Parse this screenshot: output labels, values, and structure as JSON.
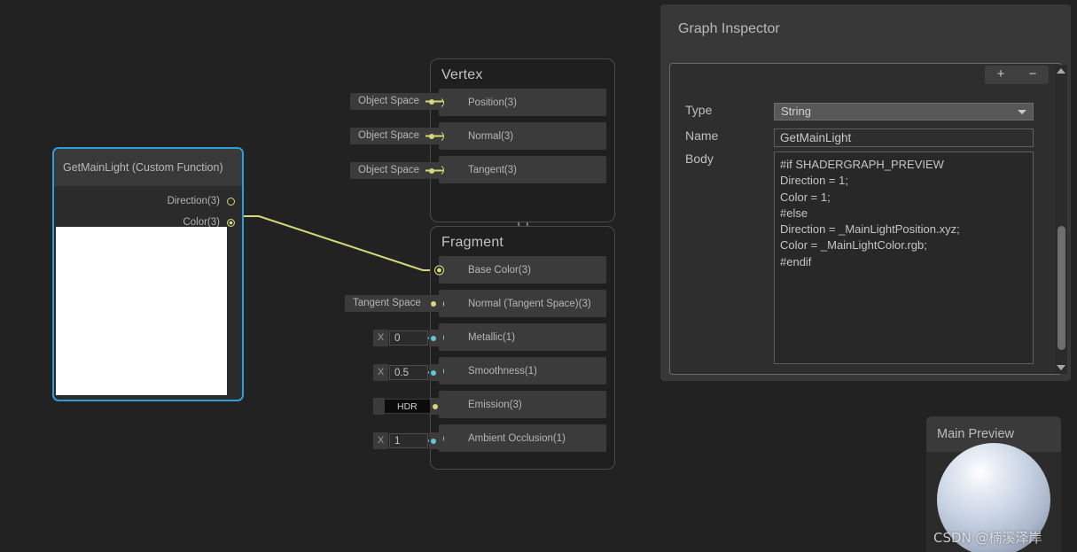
{
  "canvas": {
    "background": "#222222"
  },
  "custom_function_node": {
    "title": "GetMainLight (Custom Function)",
    "selected_border_color": "#2e9ed6",
    "ports": [
      {
        "label": "Direction(3)",
        "type": "vector3",
        "connected": false
      },
      {
        "label": "Color(3)",
        "type": "vector3",
        "connected": true
      }
    ],
    "preview_color": "#ffffff"
  },
  "vertex_stack": {
    "title": "Vertex",
    "rows": [
      {
        "label": "Position(3)",
        "control": "Object Space",
        "control_type": "dropdown",
        "port_type": "vector3"
      },
      {
        "label": "Normal(3)",
        "control": "Object Space",
        "control_type": "dropdown",
        "port_type": "vector3"
      },
      {
        "label": "Tangent(3)",
        "control": "Object Space",
        "control_type": "dropdown",
        "port_type": "vector3"
      }
    ]
  },
  "fragment_stack": {
    "title": "Fragment",
    "rows": [
      {
        "label": "Base Color(3)",
        "control": "",
        "control_type": "none",
        "port_type": "vector3",
        "connected": true
      },
      {
        "label": "Normal (Tangent Space)(3)",
        "control": "Tangent Space",
        "control_type": "dropdown",
        "port_type": "vector3"
      },
      {
        "label": "Metallic(1)",
        "control": "0",
        "control_axis": "X",
        "control_type": "float",
        "port_type": "float"
      },
      {
        "label": "Smoothness(1)",
        "control": "0.5",
        "control_axis": "X",
        "control_type": "float",
        "port_type": "float"
      },
      {
        "label": "Emission(3)",
        "control": "HDR",
        "control_type": "hdr",
        "port_type": "vector3"
      },
      {
        "label": "Ambient Occlusion(1)",
        "control": "1",
        "control_axis": "X",
        "control_type": "float",
        "port_type": "float"
      }
    ]
  },
  "inspector": {
    "title": "Graph Inspector",
    "add_label": "+",
    "remove_label": "−",
    "fields": {
      "type_label": "Type",
      "type_value": "String",
      "name_label": "Name",
      "name_value": "GetMainLight",
      "body_label": "Body",
      "body_value": "#if SHADERGRAPH_PREVIEW\nDirection = 1;\nColor = 1;\n#else\nDirection = _MainLightPosition.xyz;\nColor = _MainLightColor.rgb;\n#endif"
    }
  },
  "main_preview": {
    "title": "Main Preview",
    "watermark": "CSDN @楠溪泽岸"
  },
  "colors": {
    "wire_vector3": "#d7d77a",
    "wire_float": "#7ed0d8",
    "selection": "#2e9ed6",
    "node_body": "#2b2b2b",
    "stack_body": "#1f1f1f"
  }
}
